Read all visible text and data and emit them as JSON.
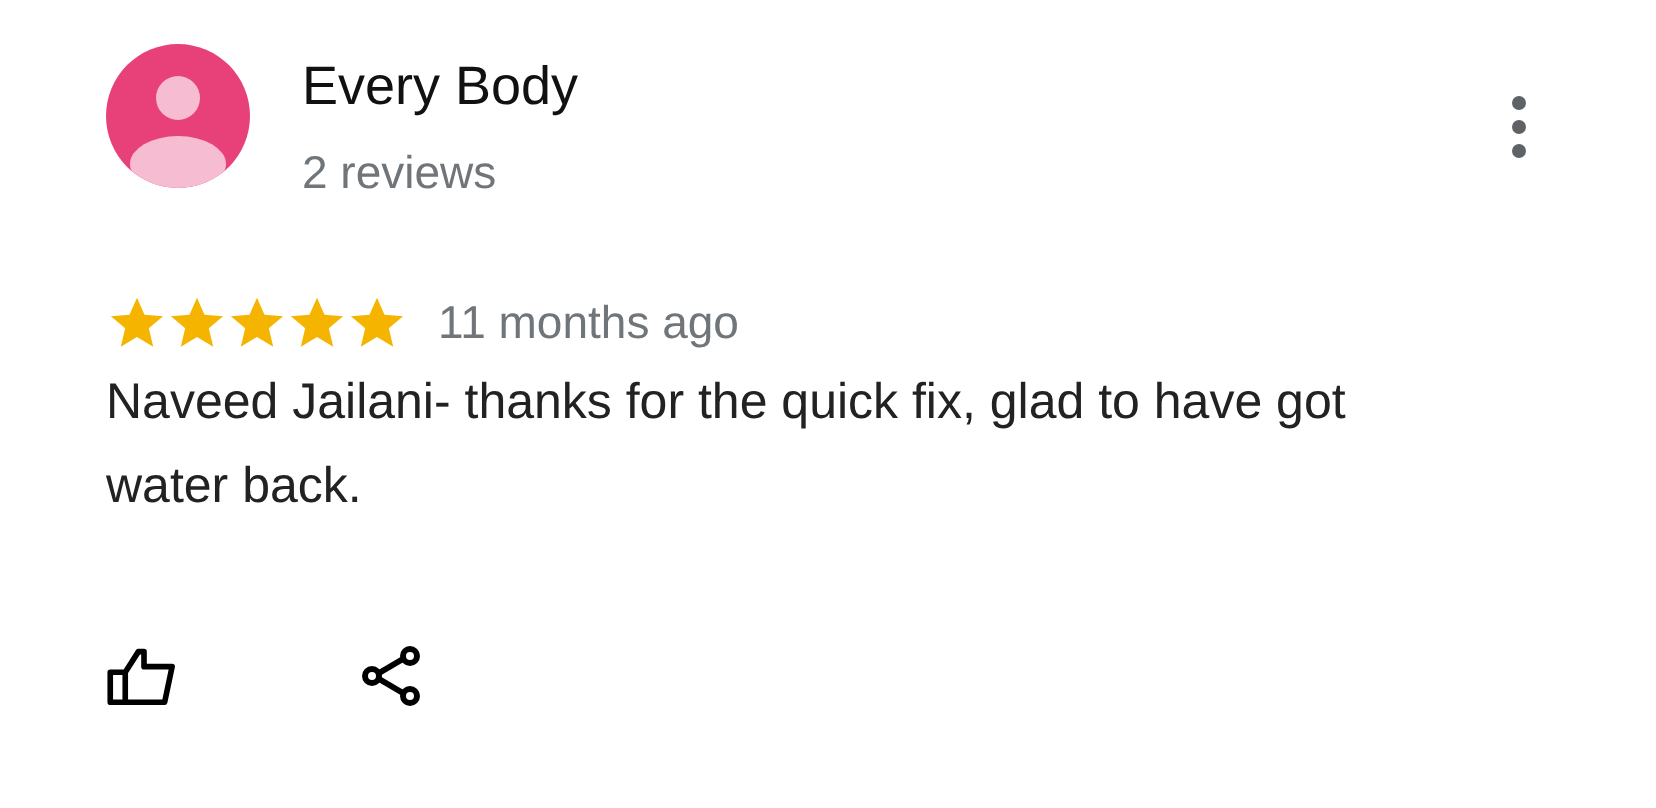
{
  "review": {
    "author": "Every Body",
    "author_reviews": "2 reviews",
    "stars": 5,
    "time": "11 months ago",
    "text": "Naveed Jailani- thanks for the quick fix, glad to have got water back."
  }
}
